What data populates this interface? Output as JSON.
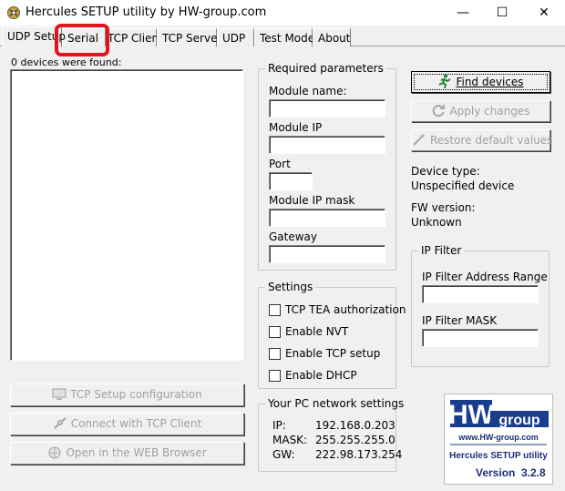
{
  "window": {
    "title": "Hercules SETUP utility by HW-group.com",
    "minimize_glyph": "—",
    "maximize_glyph": "☐",
    "close_glyph": "✕"
  },
  "tabs": [
    {
      "label": "UDP Setup"
    },
    {
      "label": "Serial"
    },
    {
      "label": "TCP Client"
    },
    {
      "label": "TCP Server"
    },
    {
      "label": "UDP"
    },
    {
      "label": "Test Mode"
    },
    {
      "label": "About"
    }
  ],
  "devices": {
    "found_label": "0 devices were found:",
    "items": []
  },
  "left_buttons": {
    "tcp_setup": "TCP Setup configuration",
    "connect_tcp": "Connect with TCP Client",
    "open_web": "Open in the WEB Browser"
  },
  "required": {
    "title": "Required parameters",
    "module_name_label": "Module name:",
    "module_name_value": "",
    "module_ip_label": "Module IP",
    "module_ip_value": "",
    "port_label": "Port",
    "port_value": "",
    "mask_label": "Module IP mask",
    "mask_value": "",
    "gateway_label": "Gateway",
    "gateway_value": ""
  },
  "settings": {
    "title": "Settings",
    "tea": "TCP TEA authorization",
    "nvt": "Enable NVT",
    "tcp_setup": "Enable TCP setup",
    "dhcp": "Enable DHCP"
  },
  "pc_network": {
    "title": "Your PC network settings",
    "ip_label": "IP:",
    "ip_value": "192.168.0.203",
    "mask_label": "MASK:",
    "mask_value": "255.255.255.0",
    "gw_label": "GW:",
    "gw_value": "222.98.173.254"
  },
  "right_buttons": {
    "find": "Find devices",
    "apply": "Apply changes",
    "restore": "Restore default values"
  },
  "device_info": {
    "type_label": "Device type:",
    "type_value": "Unspecified device",
    "fw_label": "FW version:",
    "fw_value": "Unknown"
  },
  "ip_filter": {
    "title": "IP Filter",
    "range_label": "IP Filter Address Range",
    "range_value": "",
    "mask_label": "IP Filter MASK",
    "mask_value": ""
  },
  "logo": {
    "brand_hw": "HW",
    "brand_group": "group",
    "url": "www.HW-group.com",
    "product": "Hercules SETUP utility",
    "version_label": "Version",
    "version_number": "3.2.8"
  },
  "colors": {
    "highlight": "#e2141c",
    "logo_blue": "#1a3c8c",
    "logo_text": "#1c2f78"
  }
}
